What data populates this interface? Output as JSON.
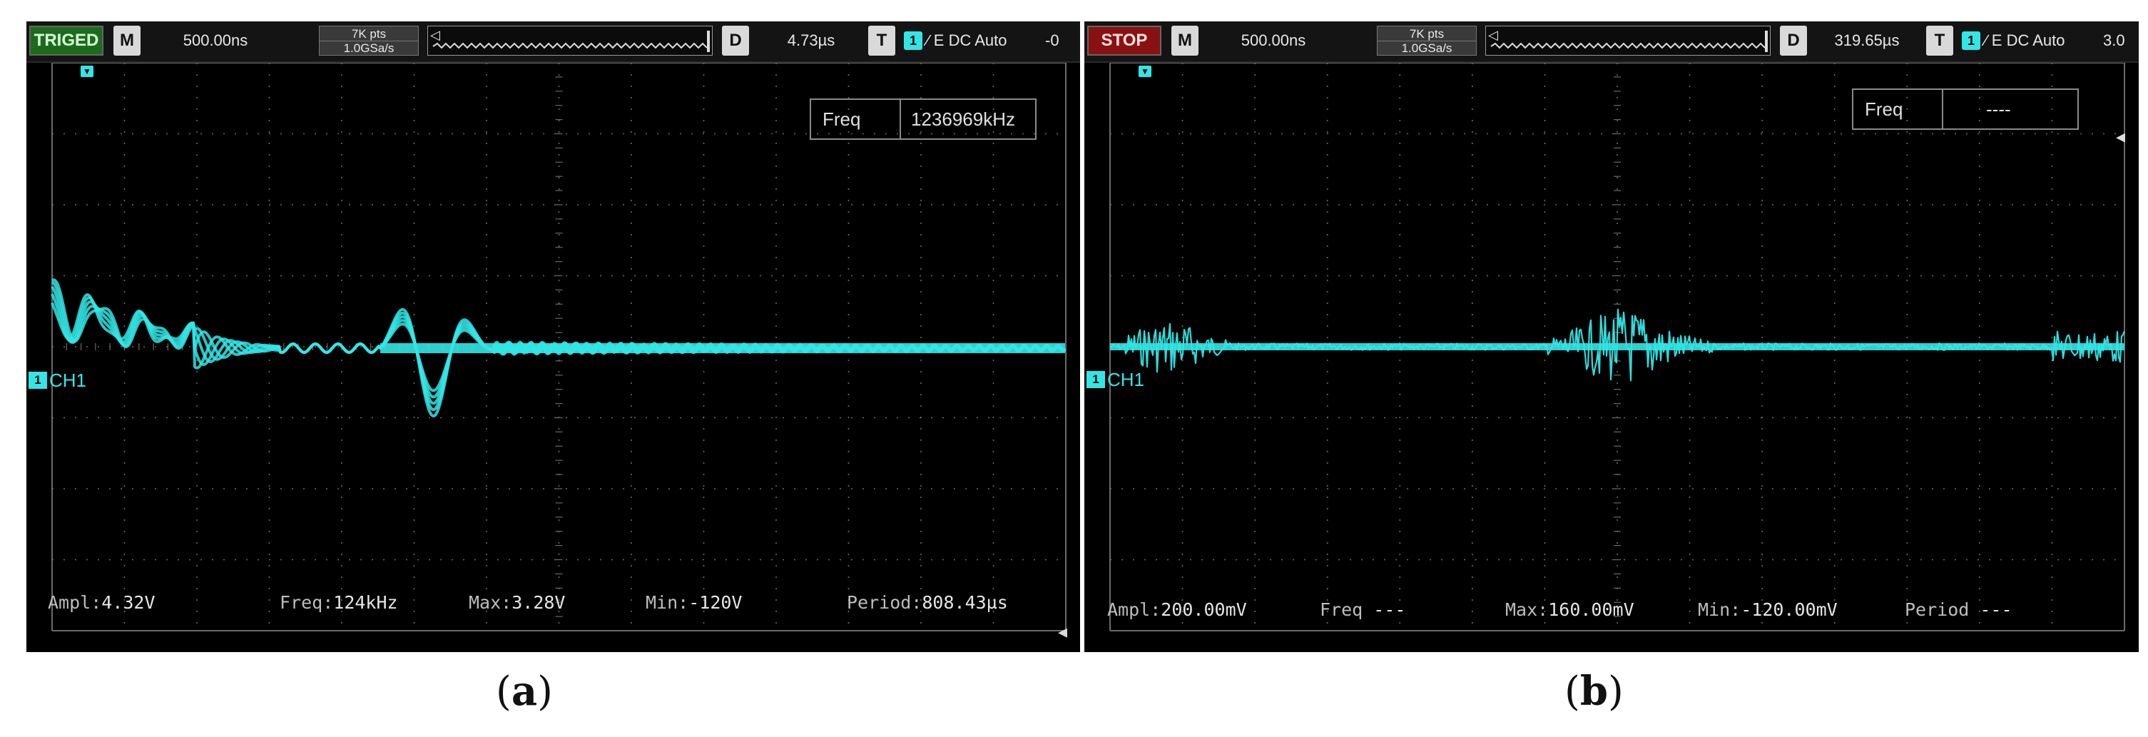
{
  "panels": [
    {
      "status": "TRIGED",
      "mode_key": "M",
      "timebase": "500.00ns",
      "points": "7K pts",
      "sample_rate": "1.0GSa/s",
      "delay_key": "D",
      "delay": "4.73µs",
      "trigger_key": "T",
      "trigger_channel": "1",
      "trigger_setup": "∕ E DC Auto",
      "trigger_level_visible": "-0",
      "freq_label": "Freq",
      "freq_value": "1236969kHz",
      "channel_label": "CH1",
      "measurements": {
        "ampl_label": "Ampl:",
        "ampl_value": "4.32V",
        "freq_label": "Freq:",
        "freq_value": "124kHz",
        "max_label": "Max:",
        "max_value": "3.28V",
        "min_label": "Min:",
        "min_value": "-120V",
        "period_label": "Period:",
        "period_value": "808.43µs"
      },
      "caption_open": "(",
      "caption_letter": "a",
      "caption_close": ")"
    },
    {
      "status": "STOP",
      "mode_key": "M",
      "timebase": "500.00ns",
      "points": "7K pts",
      "sample_rate": "1.0GSa/s",
      "delay_key": "D",
      "delay": "319.65µs",
      "trigger_key": "T",
      "trigger_channel": "1",
      "trigger_setup": "∕ E DC Auto",
      "trigger_level_visible": "3.0",
      "freq_label": "Freq",
      "freq_value": "----",
      "channel_label": "CH1",
      "measurements": {
        "ampl_label": "Ampl:",
        "ampl_value": "200.00mV",
        "freq_label": "Freq",
        "freq_value": "---",
        "max_label": "Max:",
        "max_value": "160.00mV",
        "min_label": "Min:",
        "min_value": "-120.00mV",
        "period_label": "Period",
        "period_value": "---"
      },
      "caption_open": "(",
      "caption_letter": "b",
      "caption_close": ")"
    }
  ],
  "colors": {
    "trace": "#33e6e6",
    "grid": "#6a6a6a",
    "screen": "#000000",
    "triged": "#1c6b1c",
    "stop": "#8a1111"
  },
  "icons": {
    "trigger_edge": "rising-edge-icon",
    "left_arrow": "left-arrow-icon"
  }
}
